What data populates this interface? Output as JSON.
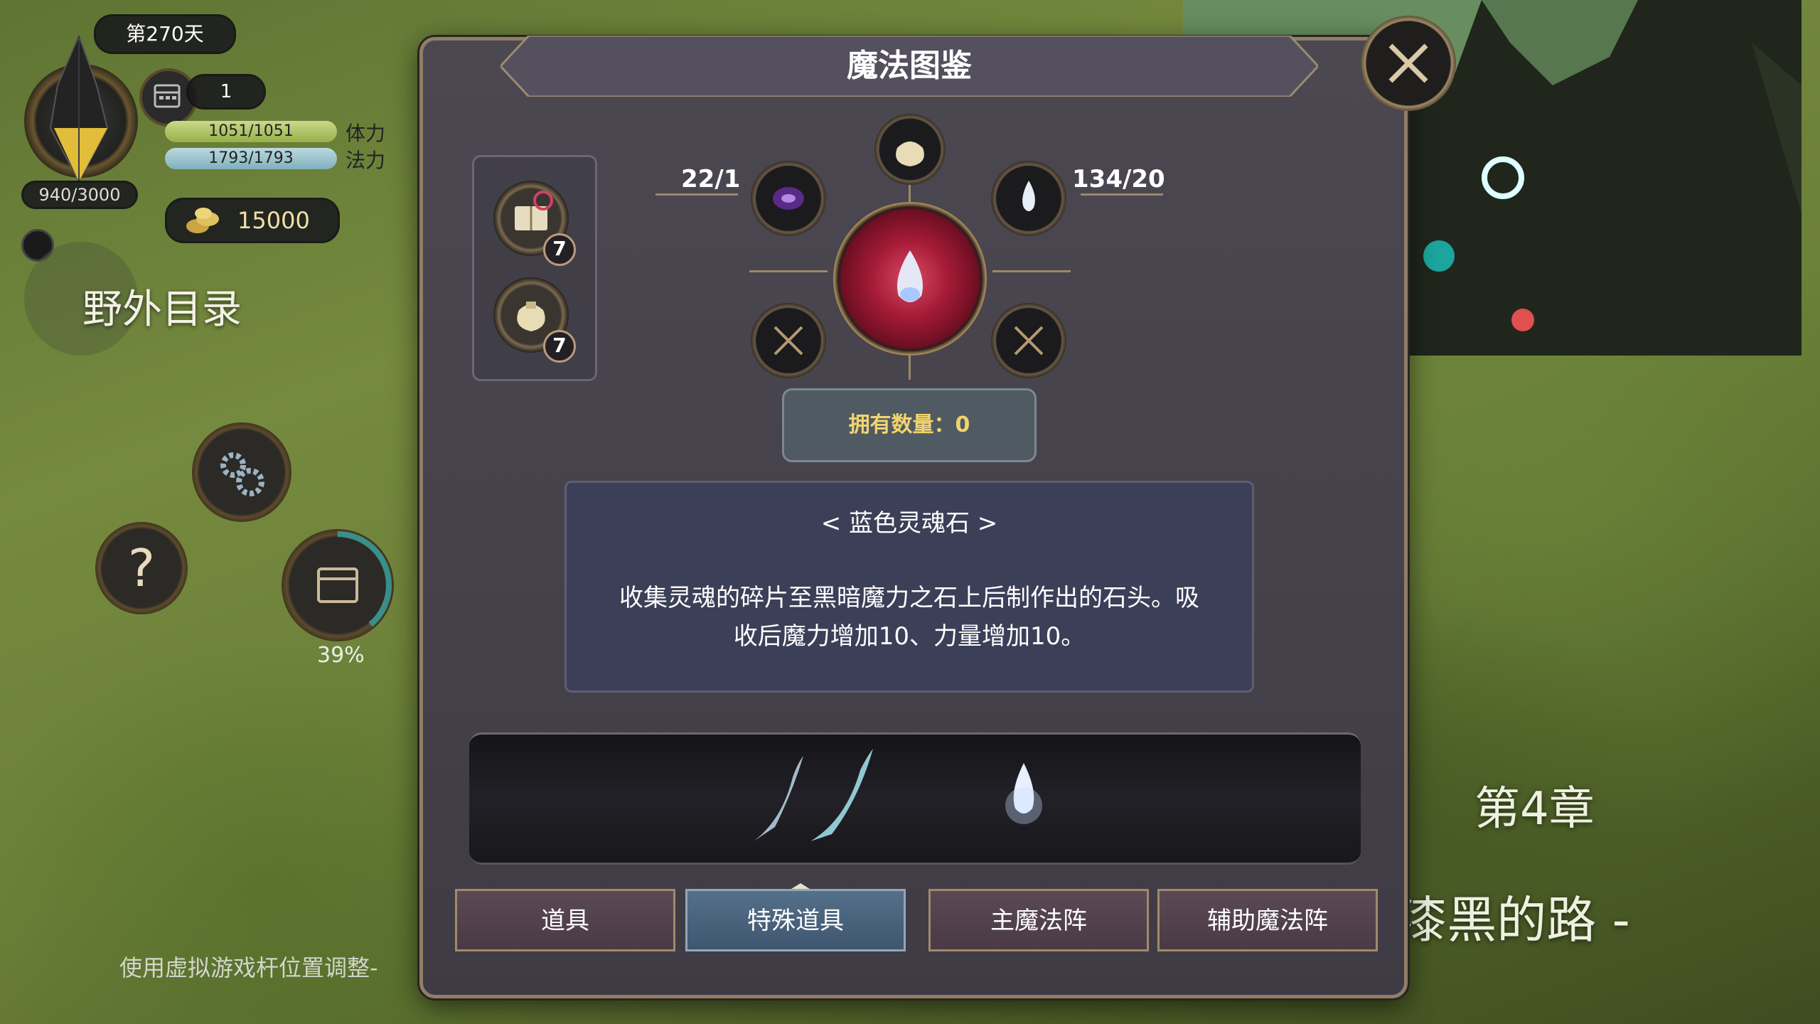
{
  "hud": {
    "day_label": "第270天",
    "calendar_count": "1",
    "hp": {
      "value": "1051/1051",
      "label": "体力"
    },
    "mp": {
      "value": "1793/1793",
      "label": "法力"
    },
    "exp": "940/3000",
    "gold": "15000",
    "field_catalog_label": "野外目录",
    "progress_percent": "39%",
    "hint": "使用虚拟游戏杆位置调整-"
  },
  "chapter": {
    "title": "第4章",
    "subtitle": "-漆黑的路 -"
  },
  "dialog": {
    "title": "魔法图鉴",
    "required_items": [
      {
        "icon": "spellbook-icon",
        "count": "7"
      },
      {
        "icon": "pouch-icon",
        "count": "7"
      }
    ],
    "stat_left": "22/1",
    "stat_right": "134/20",
    "owned_label": "拥有数量：0",
    "item_name": "< 蓝色灵魂石 >",
    "item_desc_line1": "收集灵魂的碎片至黑暗魔力之石上后制作出的石头。吸",
    "item_desc_line2": "收后魔力增加10、力量增加10。",
    "tabs": [
      {
        "label": "道具",
        "active": false
      },
      {
        "label": "特殊道具",
        "active": true
      },
      {
        "label": "主魔法阵",
        "active": false
      },
      {
        "label": "辅助魔法阵",
        "active": false
      }
    ]
  },
  "colors": {
    "accent_gold": "#f1d46d",
    "panel": "#45414b",
    "crimson_core": "#a51b37"
  }
}
